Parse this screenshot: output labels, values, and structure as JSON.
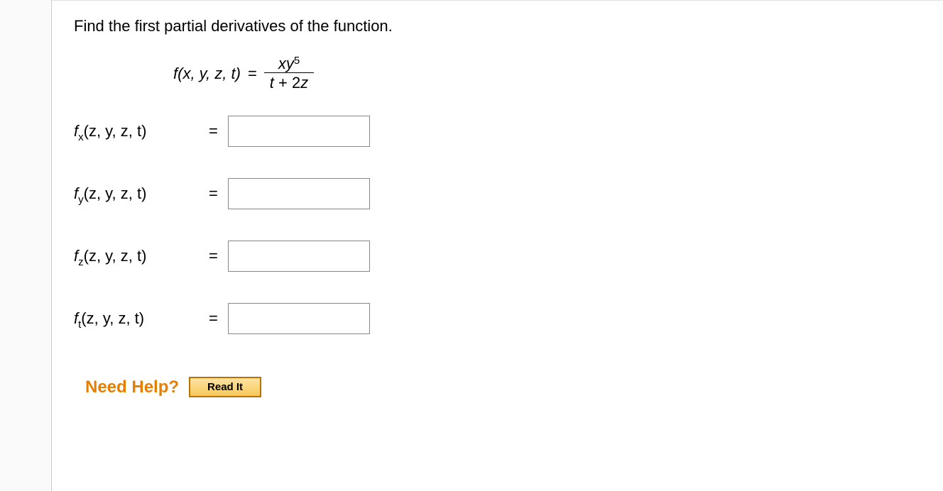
{
  "question": {
    "prompt": "Find the first partial derivatives of the function.",
    "function_lhs_f": "f",
    "function_lhs_args": "(x, y, z, t)",
    "eq": "=",
    "fraction": {
      "numerator_base": "xy",
      "numerator_exp": "5",
      "denom_t": "t",
      "denom_plus": " + 2",
      "denom_z": "z"
    }
  },
  "rows": [
    {
      "sub": "x",
      "args": "(z, y, z, t)",
      "value": ""
    },
    {
      "sub": "y",
      "args": "(z, y, z, t)",
      "value": ""
    },
    {
      "sub": "z",
      "args": "(z, y, z, t)",
      "value": ""
    },
    {
      "sub": "t",
      "args": "(z, y, z, t)",
      "value": ""
    }
  ],
  "help": {
    "label": "Need Help?",
    "read_it": "Read It"
  },
  "symbols": {
    "f": "f",
    "eq": "="
  }
}
